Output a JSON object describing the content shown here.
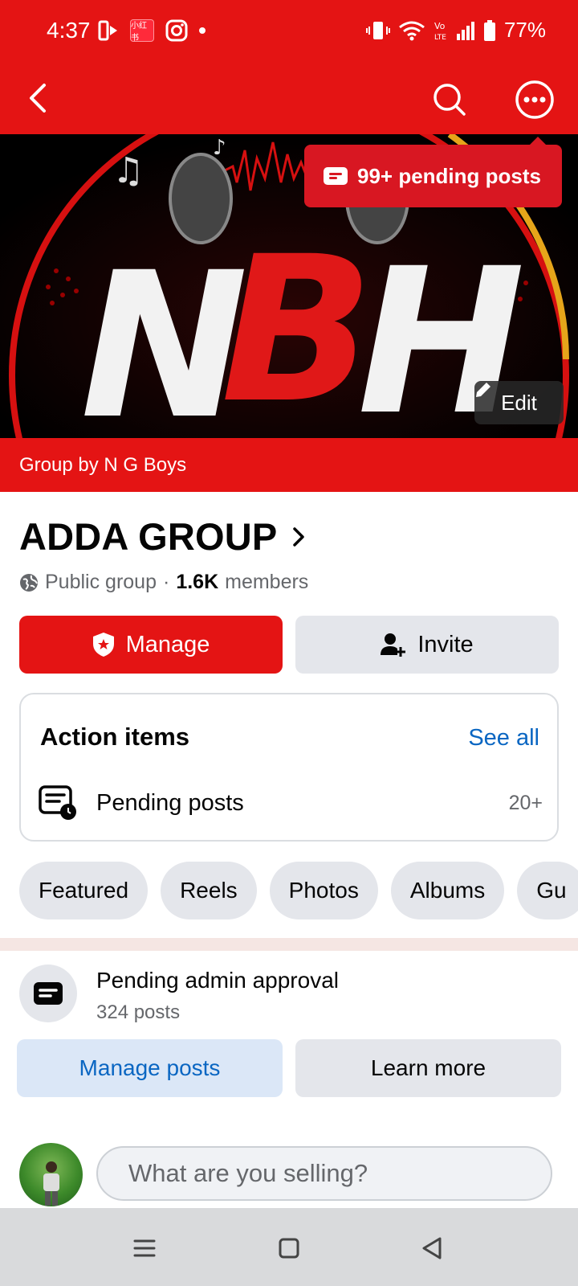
{
  "status_bar": {
    "time": "4:37",
    "mini_app_text": "小红书",
    "battery": "77%"
  },
  "app_bar": {
    "back_icon": "chevron-left-icon",
    "search_icon": "search-icon",
    "more_icon": "more-horizontal-icon"
  },
  "cover": {
    "logo_text": "NBH",
    "pending_tooltip": "99+ pending posts",
    "edit_label": "Edit"
  },
  "group": {
    "group_by": "Group by N G Boys",
    "title": "ADDA GROUP",
    "privacy": "Public group",
    "separator": "·",
    "members_count": "1.6K",
    "members_label": "members"
  },
  "actions": {
    "manage_label": "Manage",
    "invite_label": "Invite"
  },
  "action_items": {
    "title": "Action items",
    "see_all": "See all",
    "pending_posts_label": "Pending posts",
    "pending_posts_count": "20+"
  },
  "chips": [
    "Featured",
    "Reels",
    "Photos",
    "Albums",
    "Gu"
  ],
  "approval": {
    "title": "Pending admin approval",
    "subtitle": "324 posts",
    "manage_posts": "Manage posts",
    "learn_more": "Learn more"
  },
  "composer": {
    "placeholder": "What are you selling?"
  },
  "colors": {
    "brand_red": "#e41414",
    "link_blue": "#0a66c2",
    "chip_gray": "#e4e6eb"
  }
}
